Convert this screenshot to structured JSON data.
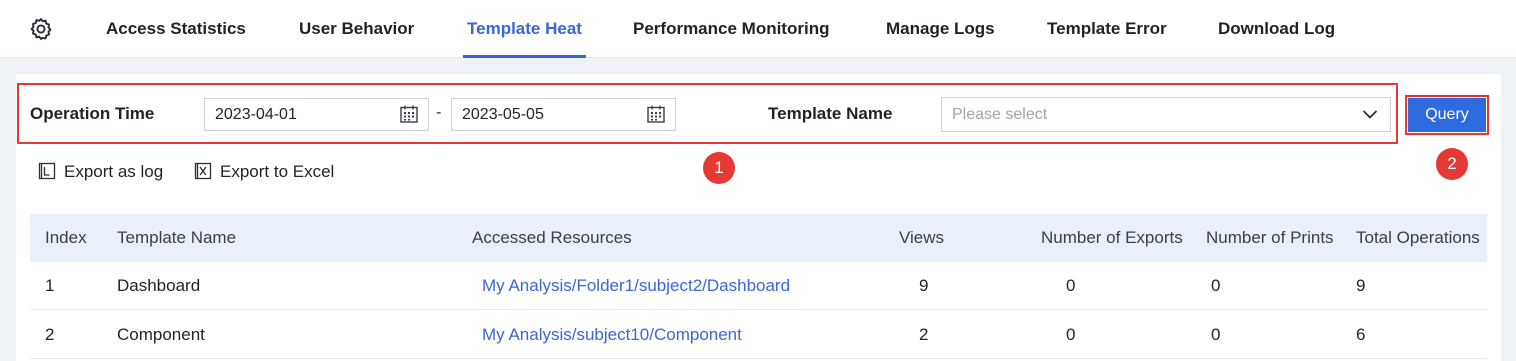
{
  "nav": {
    "tabs": [
      {
        "label": "Access Statistics"
      },
      {
        "label": "User Behavior"
      },
      {
        "label": "Template Heat"
      },
      {
        "label": "Performance Monitoring"
      },
      {
        "label": "Manage Logs"
      },
      {
        "label": "Template Error"
      },
      {
        "label": "Download Log"
      }
    ],
    "active_tab": "Template Heat"
  },
  "filters": {
    "operation_time_label": "Operation Time",
    "start_date": "2023-04-01",
    "separator": "-",
    "end_date": "2023-05-05",
    "template_name_label": "Template Name",
    "template_name_placeholder": "Please select",
    "query_label": "Query"
  },
  "badges": {
    "first": "1",
    "second": "2"
  },
  "actions": {
    "export_log": "Export as log",
    "export_excel": "Export to Excel"
  },
  "table": {
    "columns": [
      "Index",
      "Template Name",
      "Accessed Resources",
      "Views",
      "Number of Exports",
      "Number of Prints",
      "Total Operations"
    ],
    "rows": [
      [
        "1",
        "Dashboard",
        "My Analysis/Folder1/subject2/Dashboard",
        "9",
        "0",
        "0",
        "9"
      ],
      [
        "2",
        "Component",
        "My Analysis/subject10/Component",
        "2",
        "0",
        "0",
        "6"
      ]
    ]
  },
  "colors": {
    "accent": "#3a66d6",
    "highlight_red": "#e53935",
    "button_blue": "#2f6bdf"
  }
}
